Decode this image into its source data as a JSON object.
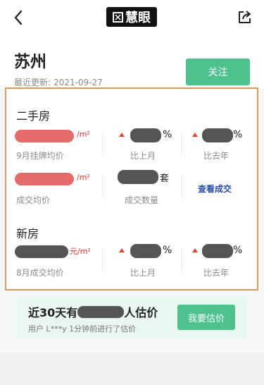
{
  "nav": {
    "logo": "慧眼",
    "icons": [
      "back-icon",
      "share-icon"
    ]
  },
  "header": {
    "city": "苏州",
    "updated_label": "最近更新:",
    "updated_date": "2021-09-27",
    "follow_label": "关注"
  },
  "second_hand": {
    "title": "二手房",
    "listing_price": {
      "unit": "/m²",
      "label": "9月挂牌均价"
    },
    "mom": {
      "unit": "%",
      "label": "比上月"
    },
    "yoy": {
      "unit": "%",
      "label": "比去年"
    },
    "deal_price": {
      "unit": "/m²",
      "label": "成交均价"
    },
    "deal_count": {
      "unit": "套",
      "label": "成交数量"
    },
    "view_deals": "查看成交"
  },
  "new_house": {
    "title": "新房",
    "deal_price": {
      "unit": "元/m²",
      "label": "8月成交均价"
    },
    "mom": {
      "unit": "%",
      "label": "比上月"
    },
    "yoy": {
      "unit": "%",
      "label": "比去年"
    }
  },
  "promo": {
    "title_prefix": "近30天有",
    "title_suffix": "人估价",
    "subtitle": "用户 L***y 1分钟前进行了估价",
    "button": "我要估价"
  },
  "colors": {
    "accent_green": "#4dc28f",
    "highlight_border": "#d79b5b",
    "up_red": "#e3462f",
    "link_blue": "#2b4fa8"
  }
}
